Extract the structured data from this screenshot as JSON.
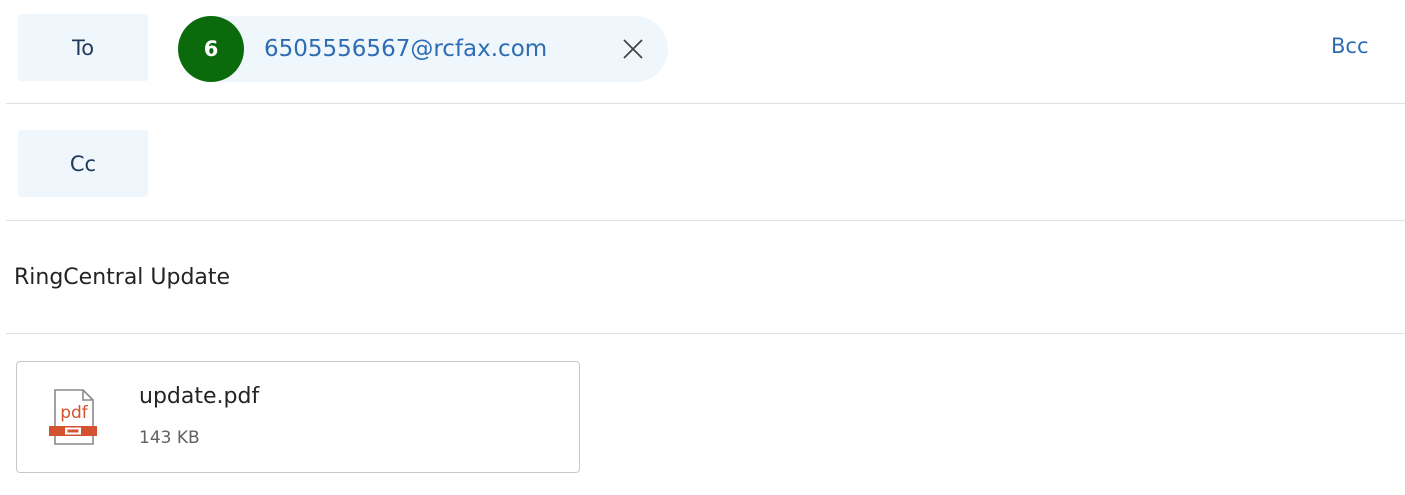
{
  "recipients": {
    "to_label": "To",
    "cc_label": "Cc",
    "bcc_label": "Bcc",
    "to_chip": {
      "initial": "6",
      "address": "6505556567@rcfax.com",
      "avatar_color": "#0b6a0b"
    }
  },
  "subject": {
    "value": "RingCentral Update"
  },
  "attachment": {
    "name": "update.pdf",
    "size": "143 KB",
    "icon": "pdf-file-icon",
    "icon_text": "pdf",
    "icon_color": "#d35230"
  },
  "colors": {
    "accent": "#2e6db3",
    "field_button_bg": "#eff6fc",
    "divider": "#e1e1e1"
  }
}
